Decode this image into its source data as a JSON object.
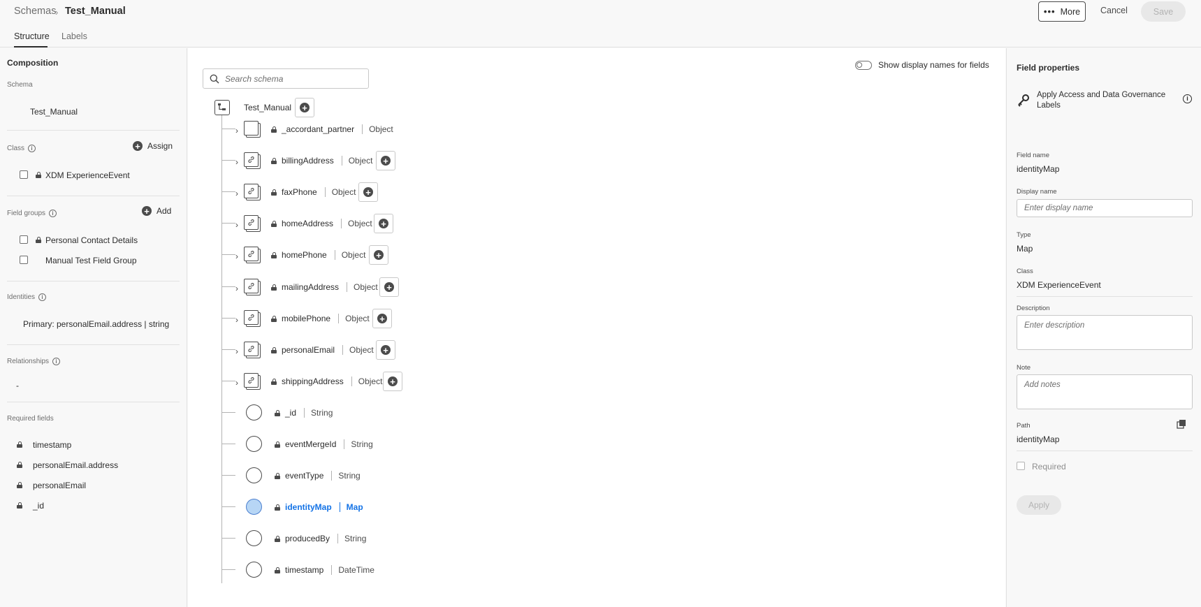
{
  "header": {
    "breadcrumb_root": "Schemas",
    "breadcrumb_current": "Test_Manual",
    "tabs": [
      {
        "label": "Structure"
      },
      {
        "label": "Labels"
      }
    ],
    "more_label": "More",
    "cancel_label": "Cancel",
    "save_label": "Save"
  },
  "composition": {
    "title": "Composition",
    "schema_label": "Schema",
    "schema_name": "Test_Manual",
    "class_label": "Class",
    "assign_label": "Assign",
    "class_name": "XDM ExperienceEvent",
    "field_groups_label": "Field groups",
    "add_label": "Add",
    "field_groups": [
      {
        "name": "Personal Contact Details"
      },
      {
        "name": "Manual Test Field Group"
      }
    ],
    "identities_label": "Identities",
    "identity_primary": "Primary: personalEmail.address | string",
    "relationships_label": "Relationships",
    "relationships_value": "-",
    "required_fields_label": "Required fields",
    "required_fields": [
      {
        "name": "timestamp"
      },
      {
        "name": "personalEmail.address"
      },
      {
        "name": "personalEmail"
      },
      {
        "name": "_id"
      }
    ]
  },
  "canvas": {
    "search_placeholder": "Search schema",
    "toggle_label": "Show display names for fields",
    "root_name": "Test_Manual",
    "fields": [
      {
        "name": "_accordant_partner",
        "type": "Object"
      },
      {
        "name": "billingAddress",
        "type": "Object"
      },
      {
        "name": "faxPhone",
        "type": "Object"
      },
      {
        "name": "homeAddress",
        "type": "Object"
      },
      {
        "name": "homePhone",
        "type": "Object"
      },
      {
        "name": "mailingAddress",
        "type": "Object"
      },
      {
        "name": "mobilePhone",
        "type": "Object"
      },
      {
        "name": "personalEmail",
        "type": "Object"
      },
      {
        "name": "shippingAddress",
        "type": "Object"
      },
      {
        "name": "_id",
        "type": "String"
      },
      {
        "name": "eventMergeId",
        "type": "String"
      },
      {
        "name": "eventType",
        "type": "String"
      },
      {
        "name": "identityMap",
        "type": "Map"
      },
      {
        "name": "producedBy",
        "type": "String"
      },
      {
        "name": "timestamp",
        "type": "DateTime"
      }
    ]
  },
  "properties": {
    "title": "Field properties",
    "governance_label": "Apply Access and Data Governance Labels",
    "field_name_label": "Field name",
    "field_name": "identityMap",
    "display_name_label": "Display name",
    "display_name_placeholder": "Enter display name",
    "type_label": "Type",
    "type_value": "Map",
    "class_label": "Class",
    "class_value": "XDM ExperienceEvent",
    "description_label": "Description",
    "description_placeholder": "Enter description",
    "note_label": "Note",
    "note_placeholder": "Add notes",
    "path_label": "Path",
    "path_value": "identityMap",
    "required_label": "Required",
    "apply_label": "Apply"
  },
  "colors": {
    "accent": "#1473e6",
    "selected_fill": "#b7d6f5"
  }
}
